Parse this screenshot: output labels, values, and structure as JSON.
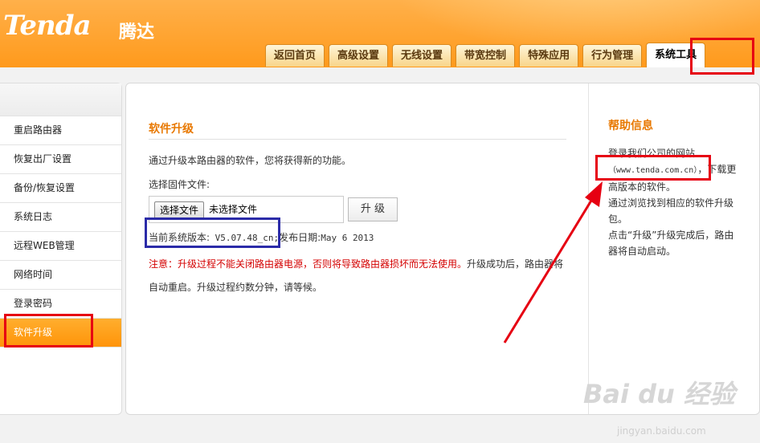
{
  "brand": {
    "logo": "Tenda",
    "logo_cn": "腾达"
  },
  "tabs": [
    {
      "label": "返回首页"
    },
    {
      "label": "高级设置"
    },
    {
      "label": "无线设置"
    },
    {
      "label": "带宽控制"
    },
    {
      "label": "特殊应用"
    },
    {
      "label": "行为管理"
    },
    {
      "label": "系统工具",
      "active": true
    }
  ],
  "sidebar": {
    "items": [
      {
        "label": "重启路由器"
      },
      {
        "label": "恢复出厂设置"
      },
      {
        "label": "备份/恢复设置"
      },
      {
        "label": "系统日志"
      },
      {
        "label": "远程WEB管理"
      },
      {
        "label": "网络时间"
      },
      {
        "label": "登录密码"
      },
      {
        "label": "软件升级",
        "active": true
      }
    ]
  },
  "main": {
    "title": "软件升级",
    "description": "通过升级本路由器的软件，您将获得新的功能。",
    "file_label": "选择固件文件:",
    "choose_button": "选择文件",
    "no_file": "未选择文件",
    "upgrade_button": "升 级",
    "version_label": "当前系统版本:",
    "version_value": "V5.07.48_cn;",
    "release_label": "发布日期:",
    "release_value": "May 6 2013",
    "notice_red": "注意：升级过程不能关闭路由器电源，否则将导致路由器损坏而无法使用。",
    "notice_rest": "升级成功后，路由器将自动重启。升级过程约数分钟，请等候。"
  },
  "help": {
    "title": "帮助信息",
    "line1": "登录我们公司的网站",
    "url": "（www.tenda.com.cn）",
    "line2": "，下载更高版本的软件。",
    "line3": "通过浏览找到相应的软件升级包。",
    "line4": "点击“升级”升级完成后，路由器将自动启动。"
  },
  "watermark": {
    "text": "Bai du 经验",
    "url": "jingyan.baidu.com"
  },
  "colors": {
    "accent": "#ff9a1c",
    "title": "#e87800",
    "notice": "#d40000",
    "annotation_red": "#e60012",
    "annotation_blue": "#2b2ba8"
  }
}
